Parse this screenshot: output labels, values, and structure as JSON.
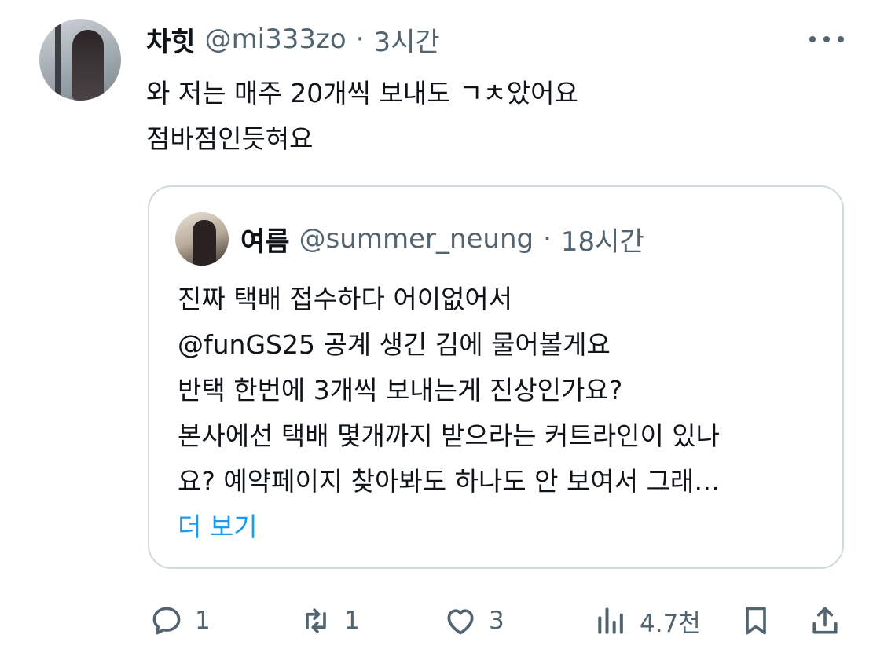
{
  "tweet": {
    "author_name": "차힛",
    "author_handle": "@mi333zo",
    "separator": "·",
    "time": "3시간",
    "text_lines": [
      "와 저는 매주 20개씩 보내도 ㄱㅊ았어요",
      "점바점인듯혀요"
    ]
  },
  "quoted": {
    "author_name": "여름",
    "author_handle": "@summer_neung",
    "separator": "·",
    "time": "18시간",
    "text_lines": [
      "진짜 택배 접수하다 어이없어서",
      "@funGS25 공계 생긴 김에 물어볼게요",
      "반택 한번에 3개씩 보내는게 진상인가요?",
      "본사에선 택배 몇개까지 받으라는 커트라인이 있나",
      "요? 예약페이지 찾아봐도 하나도 안 보여서 그래…"
    ],
    "show_more": "더 보기"
  },
  "actions": {
    "reply_count": "1",
    "retweet_count": "1",
    "like_count": "3",
    "views_count": "4.7천"
  },
  "colors": {
    "text": "#0f1419",
    "secondary": "#536471",
    "link": "#1d9bf0",
    "border": "#cfd9de"
  },
  "icons": [
    "more-icon",
    "reply-icon",
    "retweet-icon",
    "like-icon",
    "views-icon",
    "bookmark-icon",
    "share-icon"
  ]
}
